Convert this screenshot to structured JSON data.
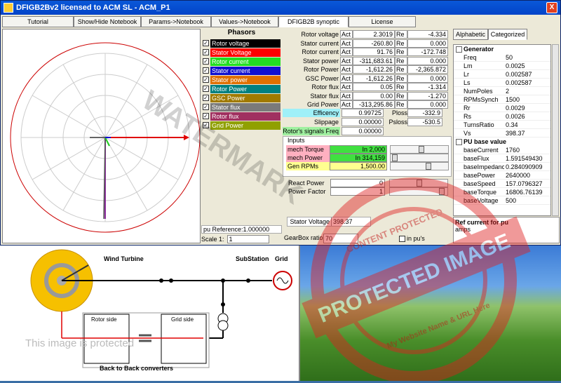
{
  "window": {
    "title": "DFIGB2Bv2  licensed to  ACM SL - ACM_P1",
    "close": "X"
  },
  "tabs": [
    "Tutorial",
    "Show/Hide Notebook",
    "Params->Notebook",
    "Values->Notebook",
    "DFIGB2B synoptic",
    "License"
  ],
  "phasors": {
    "title": "Phasors",
    "items": [
      {
        "label": "Rotor voltage",
        "color": "#000000",
        "checked": "✓"
      },
      {
        "label": "Stator Voltage",
        "color": "#ff0000",
        "checked": "✓"
      },
      {
        "label": "Rotor current",
        "color": "#22dd22",
        "checked": "✓"
      },
      {
        "label": "Stator current",
        "color": "#1010d0",
        "checked": "✓"
      },
      {
        "label": "Stator power",
        "color": "#e07000",
        "checked": "✓"
      },
      {
        "label": "Rotor Power",
        "color": "#008080",
        "checked": "✓"
      },
      {
        "label": "GSC Power",
        "color": "#a07a00",
        "checked": "✓"
      },
      {
        "label": "Stator flux",
        "color": "#7a7a7a",
        "checked": "✓"
      },
      {
        "label": "Rotor flux",
        "color": "#a03060",
        "checked": "✓"
      },
      {
        "label": "Grid Power",
        "color": "#90a000",
        "checked": "✓"
      }
    ],
    "pu_reference": "pu Reference:1.000000",
    "scale_label": "Scale 1:",
    "scale_value": "1"
  },
  "values": {
    "rows": [
      {
        "label": "Rotor voltage",
        "tag1": "Act",
        "v1": "2.3019",
        "tag2": "Re",
        "v2": "-4.334"
      },
      {
        "label": "Stator current",
        "tag1": "Act",
        "v1": "-260.80",
        "tag2": "Re",
        "v2": "0.000"
      },
      {
        "label": "Rotor current",
        "tag1": "Act",
        "v1": "91.76",
        "tag2": "Re",
        "v2": "-172.748"
      },
      {
        "label": "Stator power",
        "tag1": "Act",
        "v1": "-311,683.61",
        "tag2": "Re",
        "v2": "0.000"
      },
      {
        "label": "Rotor Power",
        "tag1": "Act",
        "v1": "-1,612.26",
        "tag2": "Re",
        "v2": "-2,365.872"
      },
      {
        "label": "GSC Power",
        "tag1": "Act",
        "v1": "-1,612.26",
        "tag2": "Re",
        "v2": "0.000"
      },
      {
        "label": "Rotor flux",
        "tag1": "Act",
        "v1": "0.05",
        "tag2": "Re",
        "v2": "-1.314"
      },
      {
        "label": "Stator flux",
        "tag1": "Act",
        "v1": "0.00",
        "tag2": "Re",
        "v2": "-1.270"
      },
      {
        "label": "Grid Power",
        "tag1": "Act",
        "v1": "-313,295.86",
        "tag2": "Re",
        "v2": "0.000"
      }
    ],
    "efficency_label": "Efficency",
    "efficency": "0.99725",
    "ploss_label": "Ploss",
    "ploss": "-332.9",
    "slippage_label": "Slippage",
    "slippage": "0.00000",
    "psloss_label": "Psloss",
    "psloss": "-530.5",
    "rotor_freq_label": "Rotor's signals Freq",
    "rotor_freq": "0.00000"
  },
  "inputs": {
    "title": "Inputs",
    "mech_torque_label": "mech Torque",
    "mech_torque": "In 2,000",
    "mech_power_label": "mech Power",
    "mech_power": "In 314,159",
    "gen_rpm_label": "Gen RPMs",
    "gen_rpm": "1,500.00",
    "react_power_label": "React Power",
    "react_power": "0",
    "power_factor_label": "Power Factor",
    "power_factor": "1"
  },
  "stator_voltage_label": "Stator Voltage",
  "stator_voltage": "398.37",
  "gearbox_label": "GearBox ratio",
  "gearbox": "70",
  "in_pus_label": "in pu's",
  "props": {
    "tabs": [
      "Alphabetic",
      "Categorized"
    ],
    "groups": [
      {
        "name": "Generator",
        "rows": [
          [
            "Freq",
            "50"
          ],
          [
            "Lm",
            "0.0025"
          ],
          [
            "Lr",
            "0.002587"
          ],
          [
            "Ls",
            "0.002587"
          ],
          [
            "NumPoles",
            "2"
          ],
          [
            "RPMsSynch",
            "1500"
          ],
          [
            "Rr",
            "0.0029"
          ],
          [
            "Rs",
            "0.0026"
          ],
          [
            "TurnsRatio",
            "0.34"
          ],
          [
            "Vs",
            "398.37"
          ]
        ]
      },
      {
        "name": "PU base value",
        "rows": [
          [
            "baseCurrent",
            "1760"
          ],
          [
            "baseFlux",
            "1.591549430"
          ],
          [
            "baseImpedance",
            "0.284090909"
          ],
          [
            "basePower",
            "2640000"
          ],
          [
            "baseSpeed",
            "157.0796327"
          ],
          [
            "baseTorque",
            "16806.76139"
          ],
          [
            "baseVoltage",
            "500"
          ]
        ]
      }
    ],
    "desc_title": "Ref current for pu",
    "desc_text": "amps"
  },
  "diagram": {
    "wind_turbine": "Wind Turbine",
    "substation": "SubStation",
    "grid": "Grid",
    "rotor_side": "Rotor side",
    "grid_side": "Grid side",
    "b2b": "Back to Back converters"
  },
  "overlay": {
    "watermark": "WATERMARK",
    "protected": "This image is protected",
    "stamp_top": "CONTENT PROTECTED",
    "stamp_main": "PROTECTED IMAGE",
    "stamp_bottom": "My Website Name & URL Here"
  }
}
